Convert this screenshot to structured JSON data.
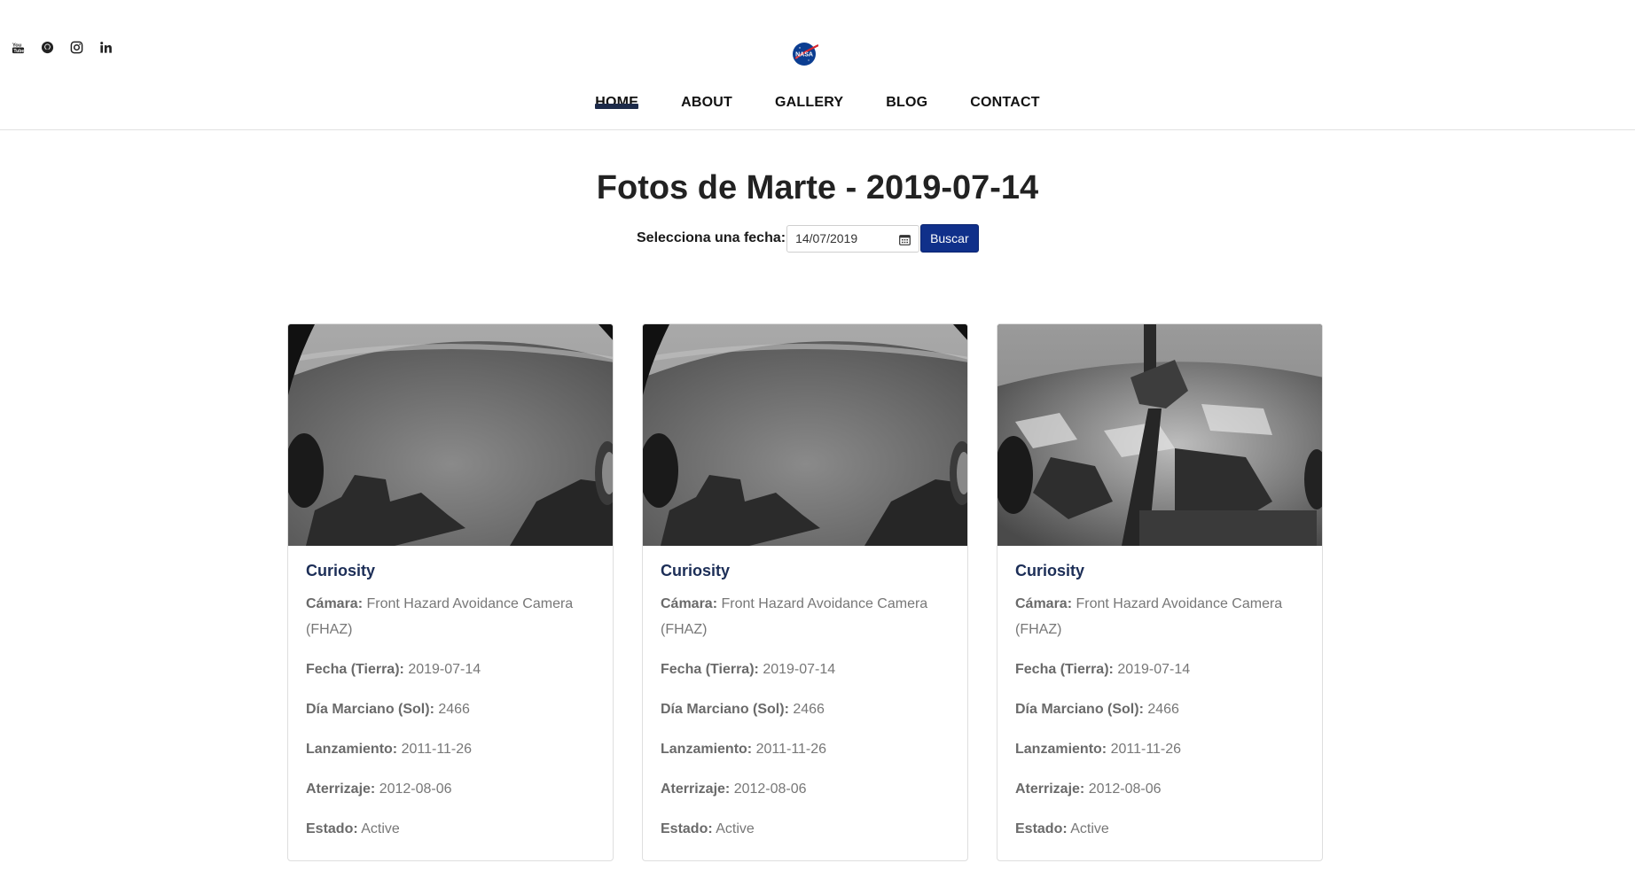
{
  "socials": [
    {
      "icon": "youtube-icon"
    },
    {
      "icon": "github-icon"
    },
    {
      "icon": "instagram-icon"
    },
    {
      "icon": "linkedin-icon"
    }
  ],
  "logo": {
    "text": "NASA",
    "icon": "nasa-logo"
  },
  "nav": {
    "items": [
      "HOME",
      "ABOUT",
      "GALLERY",
      "BLOG",
      "CONTACT"
    ],
    "active": "HOME"
  },
  "page": {
    "title": "Fotos de Marte - 2019-07-14",
    "date_label": "Selecciona una fecha:",
    "date_value": "14/07/2019",
    "search_button": "Buscar"
  },
  "colors": {
    "accent": "#10308a",
    "card_title": "#1c2e57",
    "nav_underline": "#1c2a49"
  },
  "cards": [
    {
      "rover": "Curiosity",
      "camera_label": "Cámara:",
      "camera": "Front Hazard Avoidance Camera (FHAZ)",
      "earth_date_label": "Fecha (Tierra):",
      "earth_date": "2019-07-14",
      "sol_label": "Día Marciano (Sol):",
      "sol": "2466",
      "launch_label": "Lanzamiento:",
      "launch": "2011-11-26",
      "landing_label": "Aterrizaje:",
      "landing": "2012-08-06",
      "status_label": "Estado:",
      "status": "Active"
    },
    {
      "rover": "Curiosity",
      "camera_label": "Cámara:",
      "camera": "Front Hazard Avoidance Camera (FHAZ)",
      "earth_date_label": "Fecha (Tierra):",
      "earth_date": "2019-07-14",
      "sol_label": "Día Marciano (Sol):",
      "sol": "2466",
      "launch_label": "Lanzamiento:",
      "launch": "2011-11-26",
      "landing_label": "Aterrizaje:",
      "landing": "2012-08-06",
      "status_label": "Estado:",
      "status": "Active"
    },
    {
      "rover": "Curiosity",
      "camera_label": "Cámara:",
      "camera": "Front Hazard Avoidance Camera (FHAZ)",
      "earth_date_label": "Fecha (Tierra):",
      "earth_date": "2019-07-14",
      "sol_label": "Día Marciano (Sol):",
      "sol": "2466",
      "launch_label": "Lanzamiento:",
      "launch": "2011-11-26",
      "landing_label": "Aterrizaje:",
      "landing": "2012-08-06",
      "status_label": "Estado:",
      "status": "Active"
    }
  ]
}
